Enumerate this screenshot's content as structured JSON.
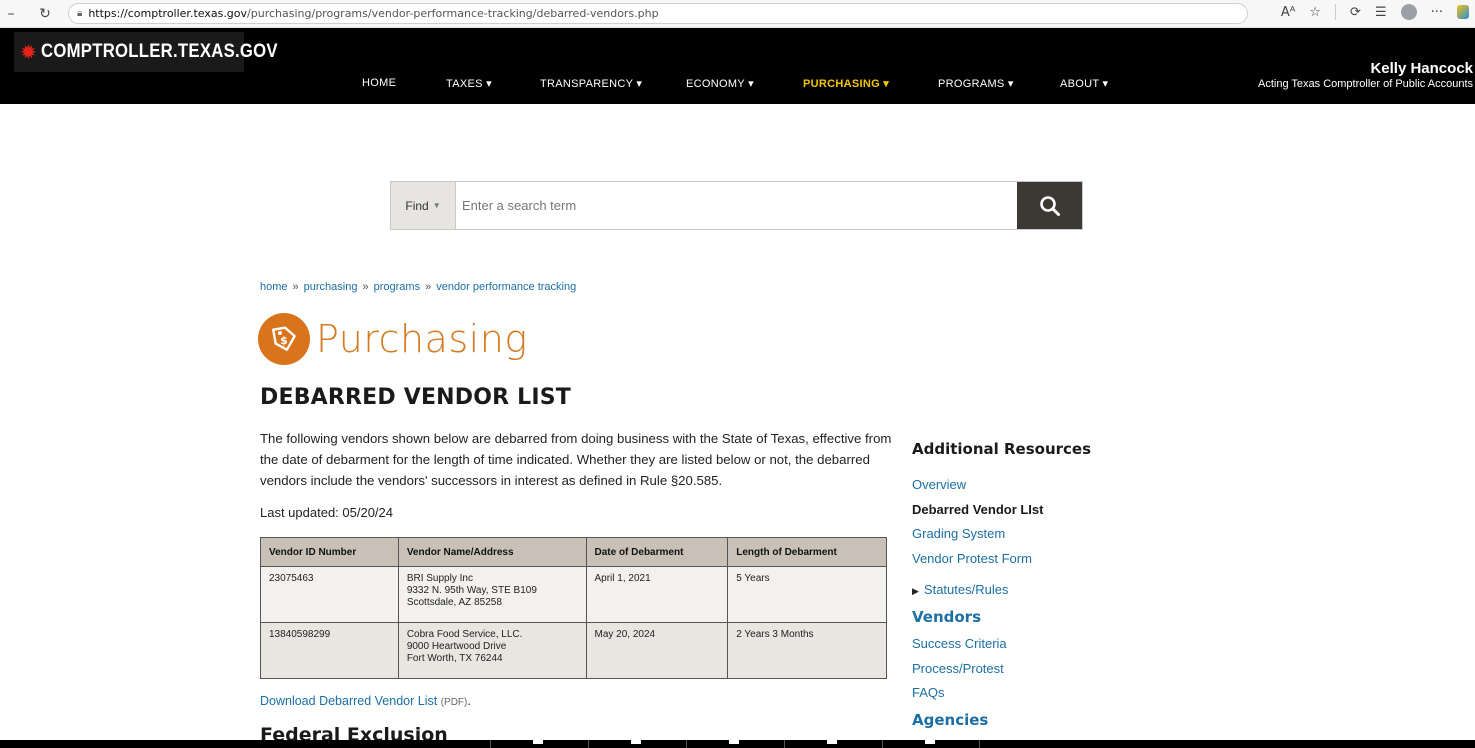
{
  "browser": {
    "url_host": "https://comptroller.texas.gov",
    "url_path": "/purchasing/programs/vendor-performance-tracking/debarred-vendors.php"
  },
  "header": {
    "logo_text": "COMPTROLLER.TEXAS.GOV",
    "official_name": "Kelly Hancock",
    "official_title": "Acting Texas Comptroller of Public Accounts",
    "nav": [
      {
        "label": "HOME"
      },
      {
        "label": "TAXES ▾"
      },
      {
        "label": "TRANSPARENCY ▾"
      },
      {
        "label": "ECONOMY ▾"
      },
      {
        "label": "PURCHASING ▾"
      },
      {
        "label": "PROGRAMS ▾"
      },
      {
        "label": "ABOUT ▾"
      }
    ]
  },
  "search": {
    "find_label": "Find",
    "placeholder": "Enter a search term"
  },
  "breadcrumb": [
    "home",
    "purchasing",
    "programs",
    "vendor performance tracking"
  ],
  "section": {
    "name": "Purchasing"
  },
  "page": {
    "title": "DEBARRED VENDOR LIST",
    "intro": "The following vendors shown below are debarred from doing business with the State of Texas, effective from the date of debarment for the length of time indicated. Whether they are listed below or not, the debarred vendors include the vendors' successors in interest as defined in Rule §20.585.",
    "last_updated": "Last updated: 05/20/24",
    "download_link": "Download Debarred Vendor List",
    "download_format": "(PDF)",
    "download_period": ".",
    "federal_heading": "Federal Exclusion"
  },
  "table": {
    "headers": [
      "Vendor ID Number",
      "Vendor Name/Address",
      "Date of Debarment",
      "Length of Debarment"
    ],
    "rows": [
      {
        "id": "23075463",
        "name": "BRI Supply Inc",
        "address1": "9332 N. 95th Way, STE B109",
        "address2": "Scottsdale, AZ 85258",
        "date": "April 1, 2021",
        "length": "5 Years"
      },
      {
        "id": "13840598299",
        "name": "Cobra Food Service, LLC.",
        "address1": "9000 Heartwood Drive",
        "address2": "Fort Worth, TX 76244",
        "date": "May 20, 2024",
        "length": "2 Years 3 Months"
      }
    ]
  },
  "sidebar": {
    "heading": "Additional Resources",
    "items": [
      {
        "label": "Overview"
      },
      {
        "label": "Debarred Vendor LIst"
      },
      {
        "label": "Grading System"
      },
      {
        "label": "Vendor Protest Form"
      }
    ],
    "toggle": "Statutes/Rules",
    "vendors_heading": "Vendors",
    "vendor_items": [
      {
        "label": "Success Criteria"
      },
      {
        "label": "Process/Protest"
      },
      {
        "label": "FAQs"
      }
    ],
    "agencies_heading": "Agencies"
  },
  "colors": {
    "accent_orange": "#d47a20",
    "link_blue": "#1b6fa3",
    "nav_active": "#f2c500"
  }
}
